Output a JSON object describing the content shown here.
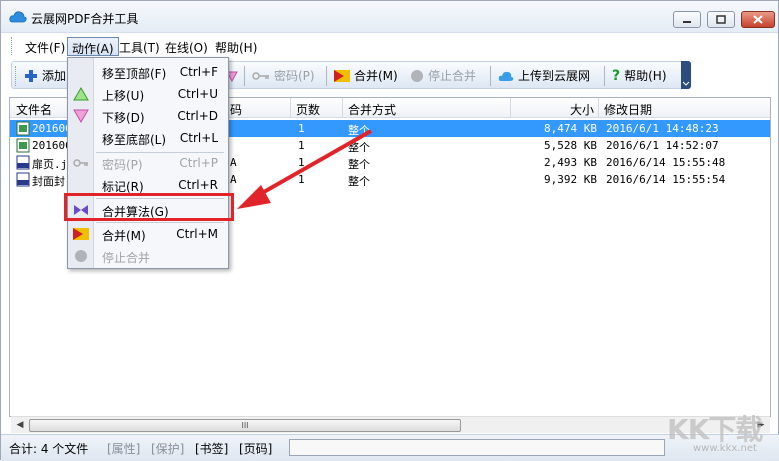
{
  "window": {
    "title": "云展网PDF合并工具",
    "controls": [
      "minimize",
      "maximize",
      "close"
    ]
  },
  "menubar": {
    "items": [
      {
        "label": "文件(F)",
        "active": false
      },
      {
        "label": "动作(A)",
        "active": true
      },
      {
        "label": "工具(T)",
        "active": false
      },
      {
        "label": "在线(O)",
        "active": false
      },
      {
        "label": "帮助(H)",
        "active": false
      }
    ]
  },
  "toolbar": {
    "add_label": "添加",
    "password_label": "密码(P)",
    "merge_label": "合并(M)",
    "stop_merge_label": "停止合并",
    "upload_label": "上传到云展网",
    "help_label": "帮助(H)"
  },
  "list": {
    "columns": [
      "文件名",
      "码",
      "页数",
      "合并方式",
      "大小",
      "修改日期"
    ],
    "rows": [
      {
        "name": "201606",
        "code": "",
        "pages": "1",
        "mode": "整个",
        "size": "8,474 KB",
        "date": "2016/6/1 14:48:23",
        "selected": true
      },
      {
        "name": "201606",
        "code": "",
        "pages": "1",
        "mode": "整个",
        "size": "5,528 KB",
        "date": "2016/6/1 14:52:07",
        "selected": false
      },
      {
        "name": "扉页.j",
        "code": "A",
        "pages": "1",
        "mode": "整个",
        "size": "2,493 KB",
        "date": "2016/6/14 15:55:48",
        "selected": false
      },
      {
        "name": "封面封",
        "code": "A",
        "pages": "1",
        "mode": "整个",
        "size": "9,392 KB",
        "date": "2016/6/14 15:55:54",
        "selected": false
      }
    ]
  },
  "dropdown": {
    "items": [
      {
        "label": "移至顶部(F)",
        "shortcut": "Ctrl+F",
        "disabled": false,
        "icon": ""
      },
      {
        "label": "上移(U)",
        "shortcut": "Ctrl+U",
        "disabled": false,
        "icon": "up-triangle-icon"
      },
      {
        "label": "下移(D)",
        "shortcut": "Ctrl+D",
        "disabled": false,
        "icon": "down-triangle-icon"
      },
      {
        "label": "移至底部(L)",
        "shortcut": "Ctrl+L",
        "disabled": false,
        "icon": ""
      },
      {
        "label": "密码(P)",
        "shortcut": "Ctrl+P",
        "disabled": true,
        "icon": "key-icon"
      },
      {
        "label": "标记(R)",
        "shortcut": "Ctrl+R",
        "disabled": false,
        "icon": ""
      },
      {
        "label": "合并算法(G)",
        "shortcut": "",
        "disabled": false,
        "icon": "bowtie-icon"
      },
      {
        "label": "合并(M)",
        "shortcut": "Ctrl+M",
        "disabled": false,
        "icon": "merge-flag-icon"
      },
      {
        "label": "停止合并",
        "shortcut": "",
        "disabled": true,
        "icon": "stop-circle-icon"
      }
    ]
  },
  "scrollbar": {
    "thumb_grip": "III"
  },
  "status": {
    "total": "合计: 4 个文件",
    "attr": "[属性]",
    "protect": "[保护]",
    "bookmark": "[书签]",
    "pagecode": "[页码]"
  },
  "watermark": {
    "text": "KK下载",
    "url": "www.kkx.net"
  },
  "colors": {
    "selection": "#3399ff",
    "highlight": "#e0242a",
    "accent": "#2c4c80"
  }
}
